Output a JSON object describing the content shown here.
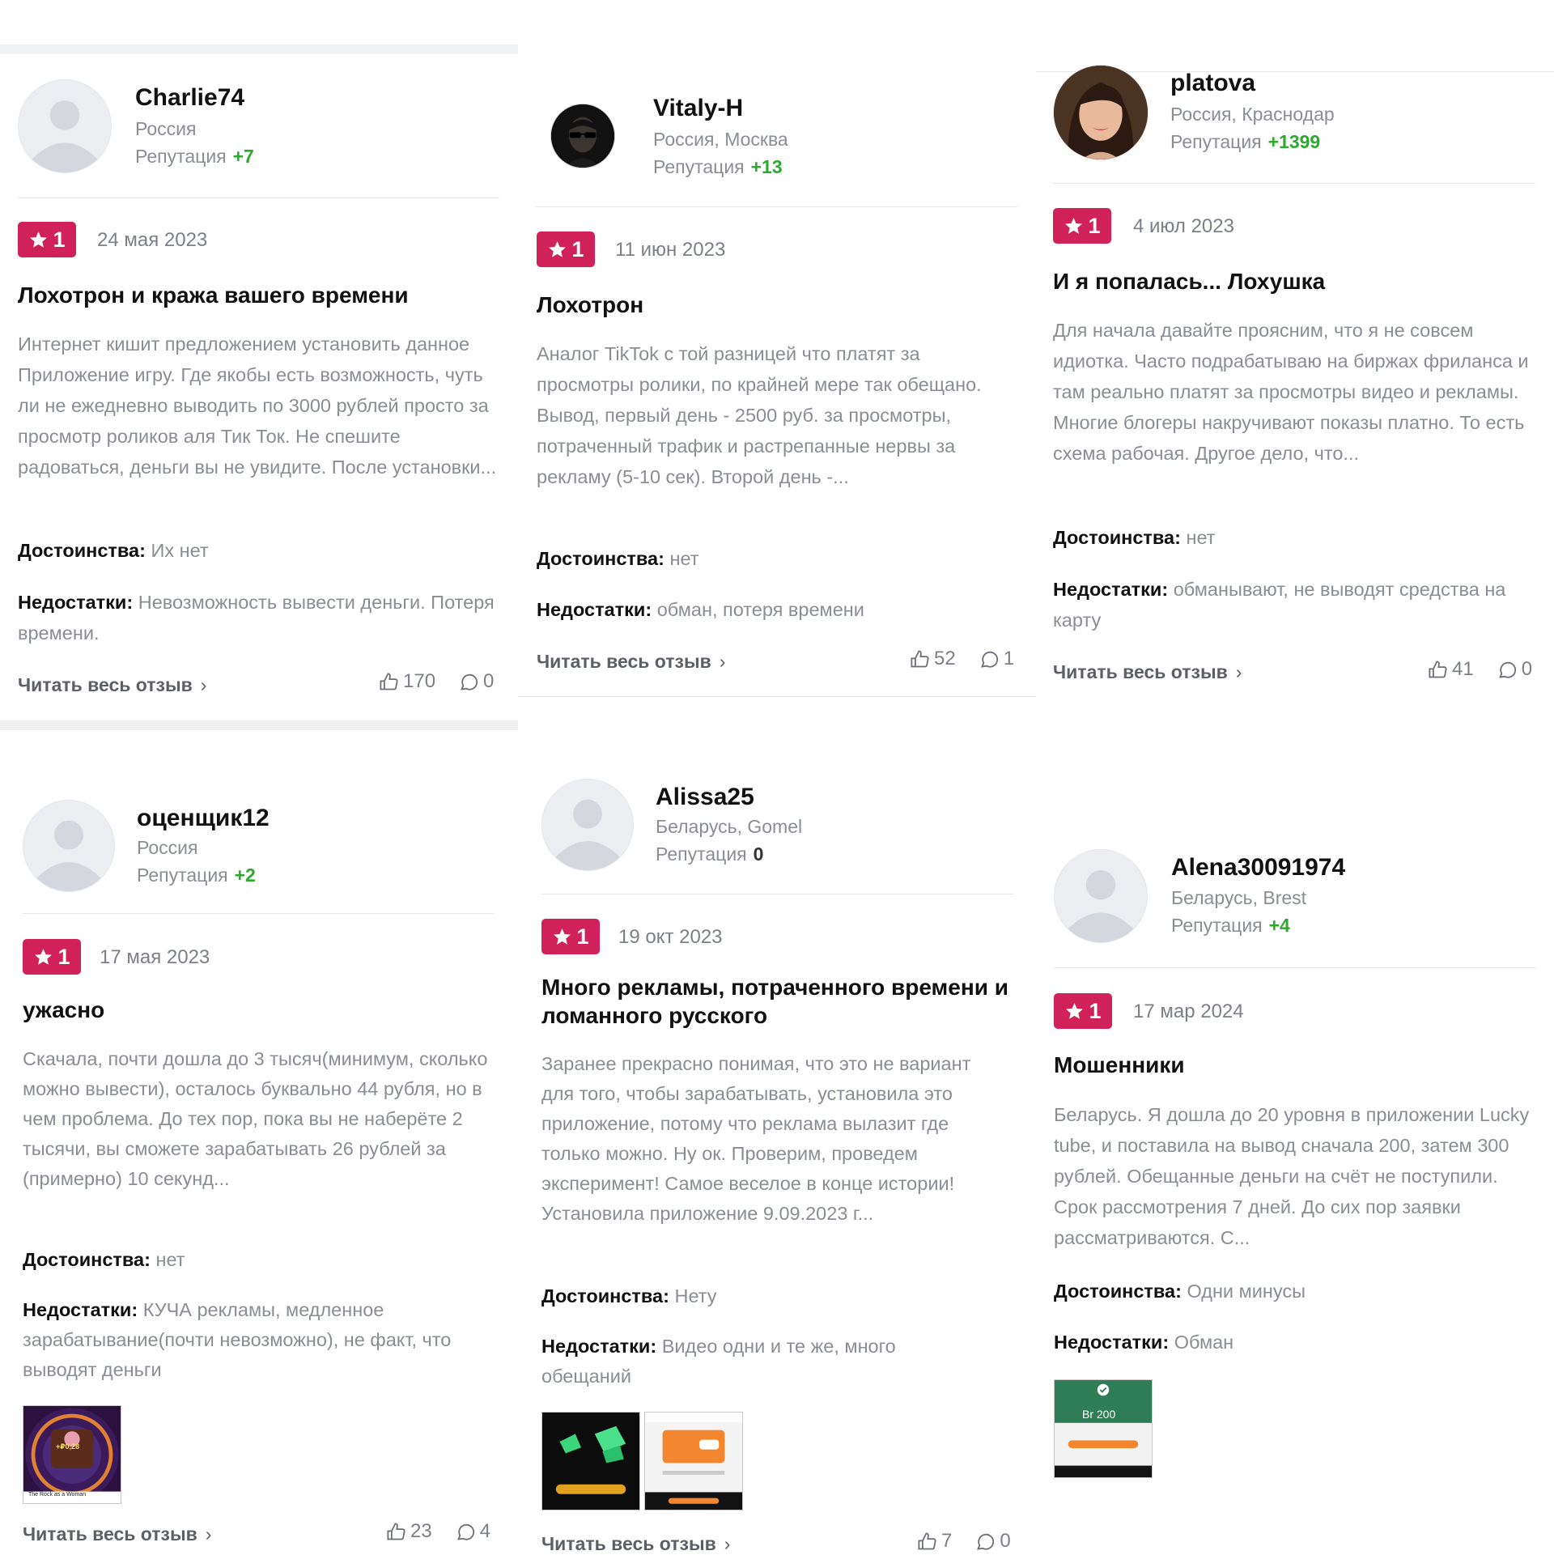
{
  "common": {
    "pros_label": "Достоинства:",
    "cons_label": "Недостатки:",
    "read_more": "Читать весь отзыв",
    "reputation_label": "Репутация",
    "colors": {
      "rating_badge": "#d1215a",
      "reputation_positive": "#2ea82e",
      "muted_text": "#8a8d93"
    }
  },
  "reviews": [
    {
      "author": "Charlie74",
      "location": "Россия",
      "reputation": "+7",
      "avatar": "default-avatar-icon",
      "rating": "1",
      "date": "24 мая 2023",
      "title": "Лохотрон и кража вашего времени",
      "text": "Интернет кишит предложением установить данное Приложение игру. Где якобы есть возможность, чуть ли не ежедневно выводить по 3000 рублей просто за просмотр роликов аля Тик Ток. Не спешите радоваться, деньги вы не увидите. После установки...",
      "pros": "Их нет",
      "cons": "Невозможность вывести деньги. Потеря времени.",
      "likes": "170",
      "comments": "0"
    },
    {
      "author": "Vitaly-H",
      "location": "Россия, Москва",
      "reputation": "+13",
      "avatar": "sunglasses-avatar-photo",
      "rating": "1",
      "date": "11 июн 2023",
      "title": "Лохотрон",
      "text": "Аналог TikTok с той разницей что платят за просмотры ролики, по крайней мере так обещано. Вывод, первый день - 2500 руб. за просмотры, потраченный трафик и растрепанные нервы за рекламу (5-10 сек). Второй день -...",
      "pros": "нет",
      "cons": "обман, потеря времени",
      "likes": "52",
      "comments": "1"
    },
    {
      "author": "platova",
      "location": "Россия, Краснодар",
      "reputation": "+1399",
      "avatar": "woman-avatar-photo",
      "rating": "1",
      "date": "4 июл 2023",
      "title": "И я попалась... Лохушка",
      "text": "Для начала давайте проясним, что я не совсем идиотка. Часто подрабатываю на биржах фриланса и там реально платят за просмотры видео и рекламы. Многие блогеры накручивают показы платно. То есть схема рабочая. Другое дело, что...",
      "pros": "нет",
      "cons": "обманывают, не выводят средства на карту",
      "likes": "41",
      "comments": "0"
    },
    {
      "author": "оценщик12",
      "location": "Россия",
      "reputation": "+2",
      "avatar": "default-avatar-icon",
      "rating": "1",
      "date": "17 мая 2023",
      "title": "ужасно",
      "text": "Скачала, почти дошла до 3 тысяч(минимум, сколько можно вывести), осталось буквально 44 рубля, но в чем проблема. До тех пор, пока вы не наберёте 2 тысячи, вы сможете зарабатывать 26 рублей за (примерно) 10 секунд...",
      "pros": "нет",
      "cons": "КУЧА рекламы, медленное зарабатывание(почти невозможно), не факт, что выводят деньги",
      "photos": [
        {
          "caption": "+₽0,28",
          "footer": "The Rock as a Woman"
        }
      ],
      "likes": "23",
      "comments": "4"
    },
    {
      "author": "Alissa25",
      "location": "Беларусь, Gomel",
      "reputation": "0",
      "avatar": "default-avatar-icon",
      "rating": "1",
      "date": "19 окт 2023",
      "title": "Много рекламы, потраченного времени и ломанного русского",
      "text": "Заранее прекрасно понимая, что это не вариант для того, чтобы зарабатывать, установила это приложение, потому что реклама вылазит где только можно. Ну ок. Проверим, проведем эксперимент! Самое веселое в конце истории! Установила приложение 9.09.2023 г...",
      "pros": "Нету",
      "cons": "Видео одни и те же, много обещаний",
      "photos": [
        {
          "caption": "money-screenshot"
        },
        {
          "caption": "payout-screenshot"
        }
      ],
      "likes": "7",
      "comments": "0"
    },
    {
      "author": "Alena30091974",
      "location": "Беларусь, Brest",
      "reputation": "+4",
      "avatar": "default-avatar-icon",
      "rating": "1",
      "date": "17 мар 2024",
      "title": "Мошенники",
      "text": "Беларусь. Я дошла до 20 уровня в приложении Lucky tube, и поставила на вывод сначала 200, затем 300 рублей. Обещанные деньги на счёт не поступили. Срок рассмотрения 7 дней. До сих пор заявки рассматриваются. С...",
      "pros": "Одни минусы",
      "cons": "Обман",
      "photos": [
        {
          "caption": "Br 200"
        }
      ]
    }
  ]
}
